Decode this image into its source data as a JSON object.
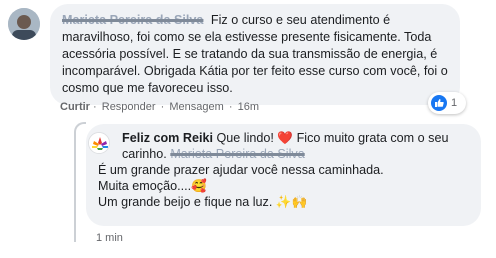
{
  "comment": {
    "author": "Marieta Pereira da Silva",
    "text": "Fiz o curso e seu atendimento é maravilhoso, foi como se ela estivesse presente fisicamente. Toda acessória possível. E se tratando da sua transmissão de energia, é incomparável. Obrigada Kátia por ter feito esse curso com você, foi o cosmo que me favoreceu isso.",
    "actions": {
      "like": "Curtir",
      "reply": "Responder",
      "message": "Mensagem",
      "time": "16m",
      "sep": "·"
    },
    "reactions": {
      "count": "1",
      "icon": "thumbs-up-icon"
    }
  },
  "reply": {
    "author": "Feliz com Reiki",
    "line1": "Que lindo! ❤️ Fico muito grata com o seu carinho.",
    "mention": "Marieta Pereira da Silva",
    "line2": "É um grande prazer ajudar você nessa caminhada.",
    "line3": "Muita emoção....🥰",
    "line4": "Um grande beijo e fique na luz. ✨🙌",
    "time": "1 min"
  },
  "colors": {
    "bubble": "#f0f2f5",
    "like_blue": "#1877f2",
    "meta_text": "#65676b"
  }
}
